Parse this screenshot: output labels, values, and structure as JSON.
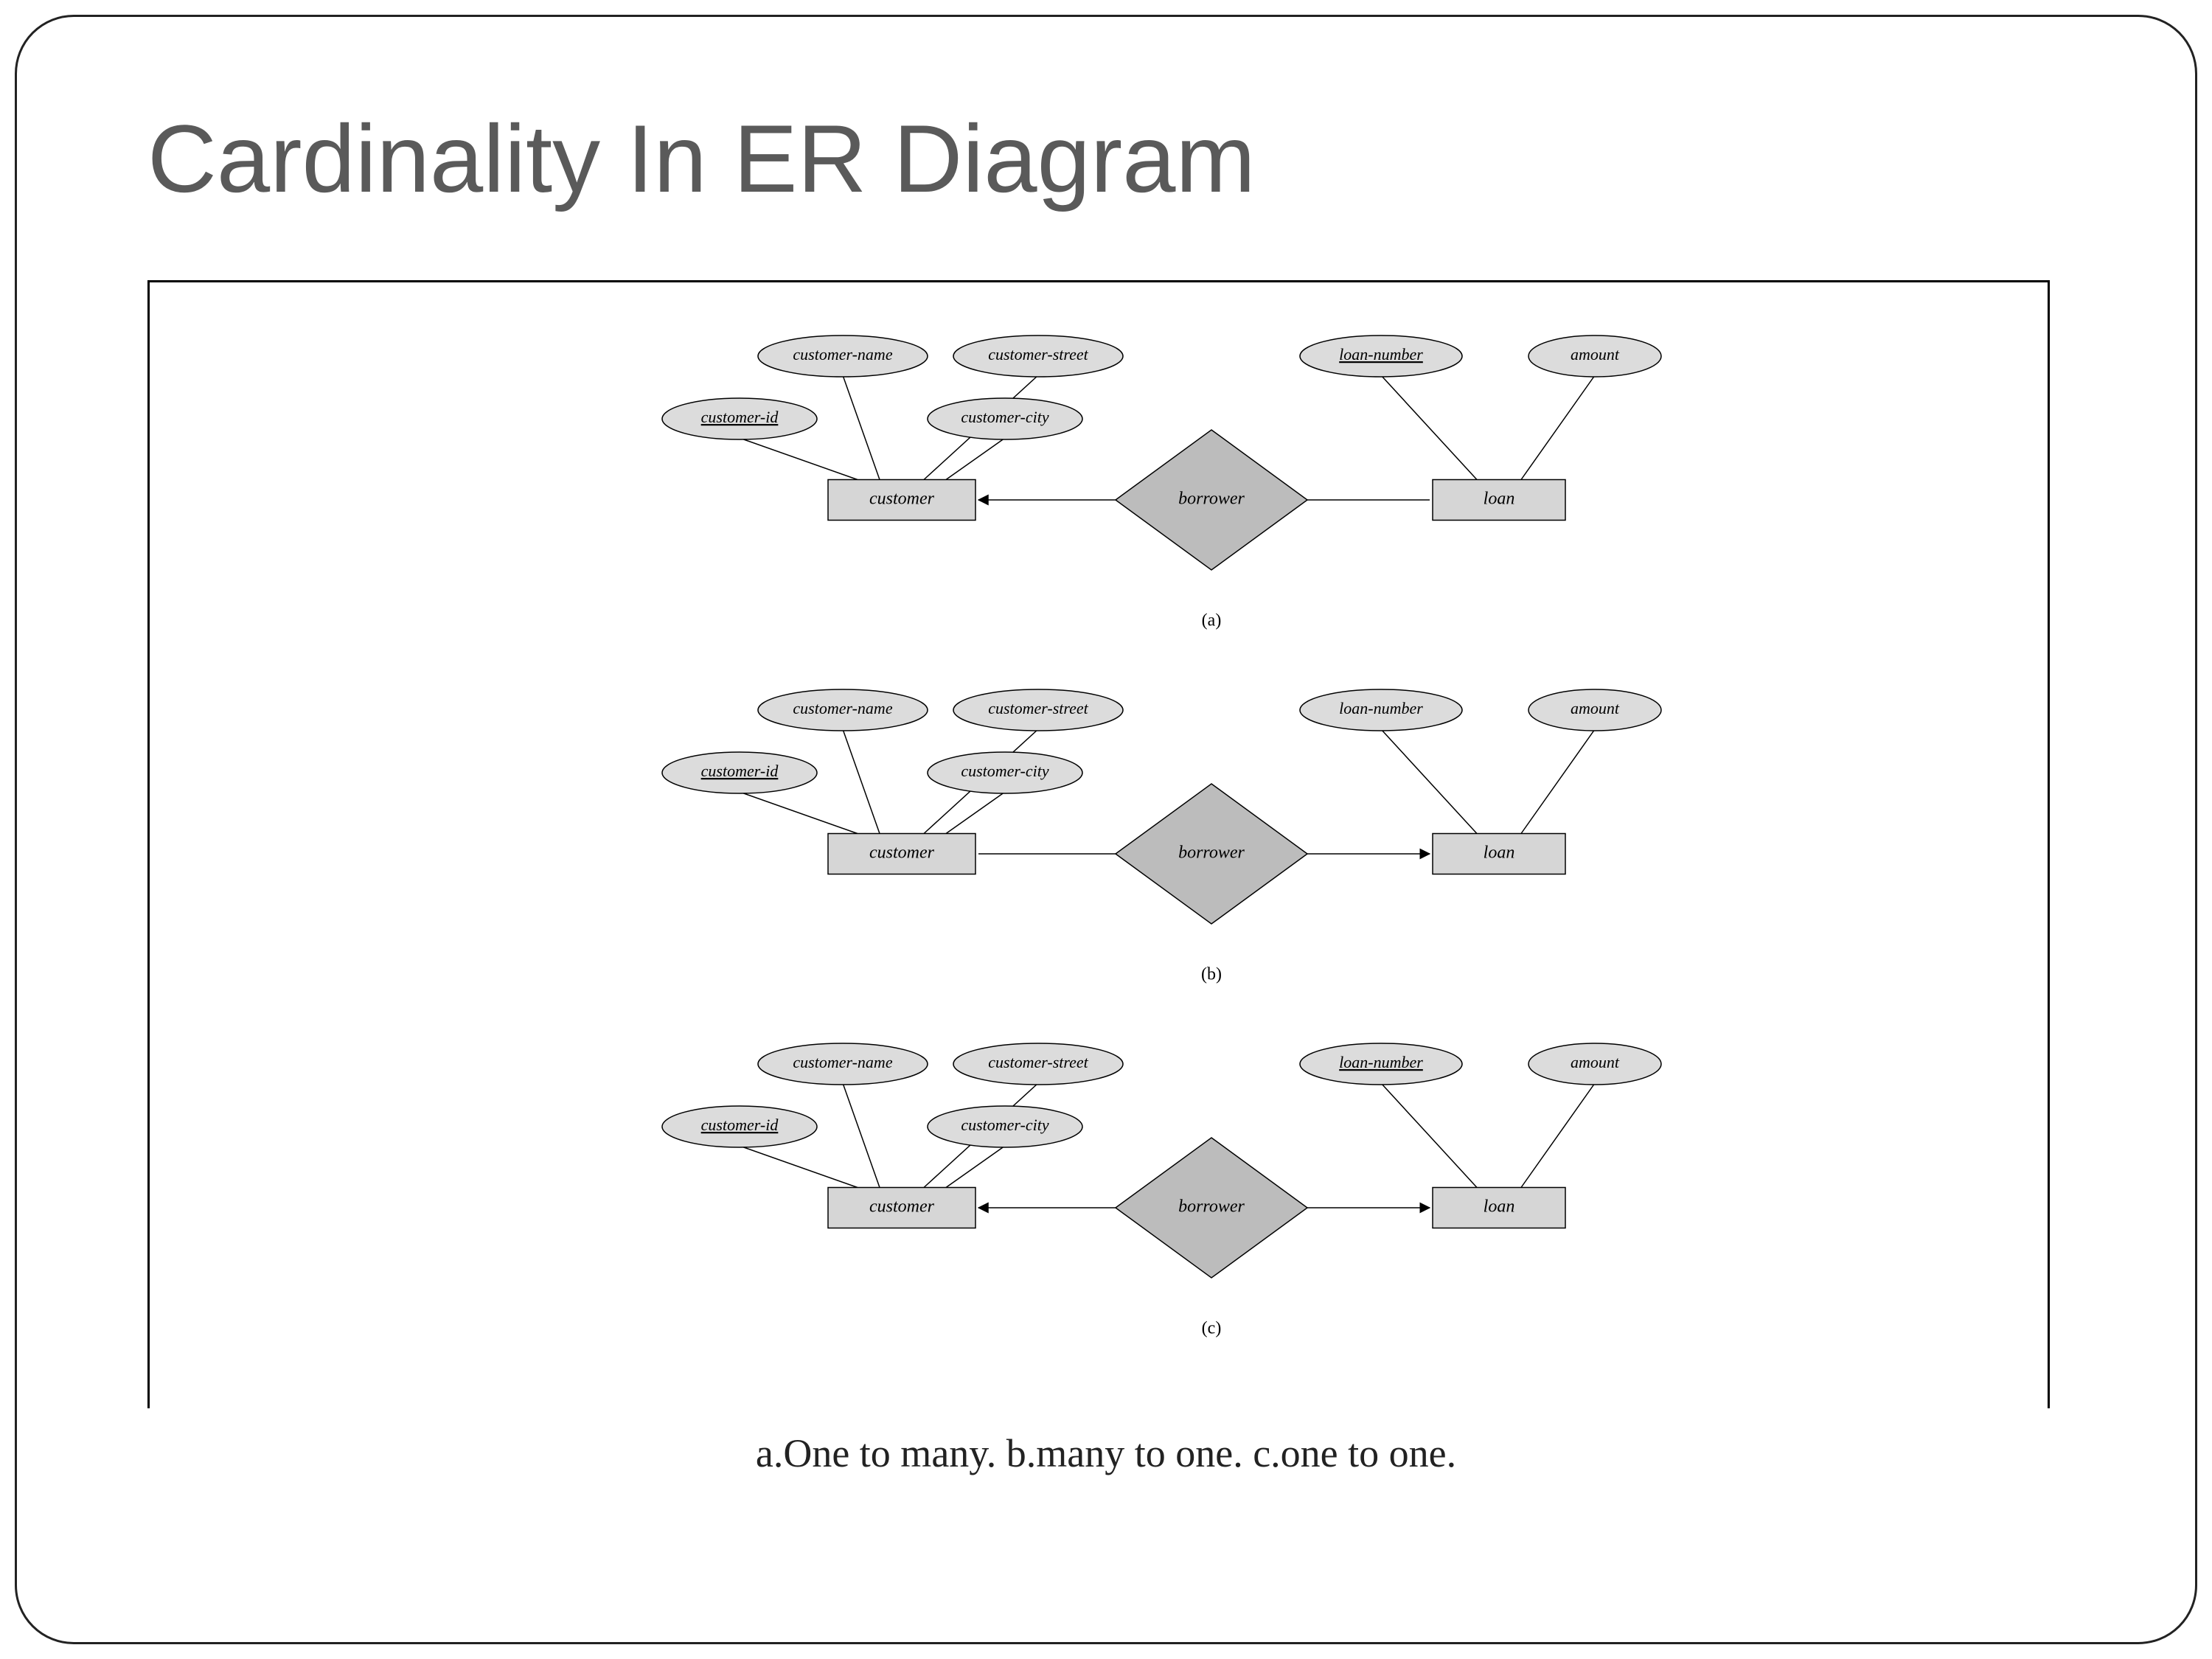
{
  "title": "Cardinality In ER Diagram",
  "caption": "a.One to many. b.many to one. c.one to one.",
  "diagrams": [
    {
      "tag": "(a)",
      "entities": {
        "left": "customer",
        "right": "loan"
      },
      "relationship": "borrower",
      "left_attrs": [
        {
          "name": "customer-name",
          "key": false
        },
        {
          "name": "customer-street",
          "key": false
        },
        {
          "name": "customer-id",
          "key": true
        },
        {
          "name": "customer-city",
          "key": false
        }
      ],
      "right_attrs": [
        {
          "name": "loan-number",
          "key": true
        },
        {
          "name": "amount",
          "key": false
        }
      ],
      "arrows": {
        "to_left": true,
        "to_right": false
      }
    },
    {
      "tag": "(b)",
      "entities": {
        "left": "customer",
        "right": "loan"
      },
      "relationship": "borrower",
      "left_attrs": [
        {
          "name": "customer-name",
          "key": false
        },
        {
          "name": "customer-street",
          "key": false
        },
        {
          "name": "customer-id",
          "key": true
        },
        {
          "name": "customer-city",
          "key": false
        }
      ],
      "right_attrs": [
        {
          "name": "loan-number",
          "key": false
        },
        {
          "name": "amount",
          "key": false
        }
      ],
      "arrows": {
        "to_left": false,
        "to_right": true
      }
    },
    {
      "tag": "(c)",
      "entities": {
        "left": "customer",
        "right": "loan"
      },
      "relationship": "borrower",
      "left_attrs": [
        {
          "name": "customer-name",
          "key": false
        },
        {
          "name": "customer-street",
          "key": false
        },
        {
          "name": "customer-id",
          "key": true
        },
        {
          "name": "customer-city",
          "key": false
        }
      ],
      "right_attrs": [
        {
          "name": "loan-number",
          "key": true
        },
        {
          "name": "amount",
          "key": false
        }
      ],
      "arrows": {
        "to_left": true,
        "to_right": true
      }
    }
  ]
}
